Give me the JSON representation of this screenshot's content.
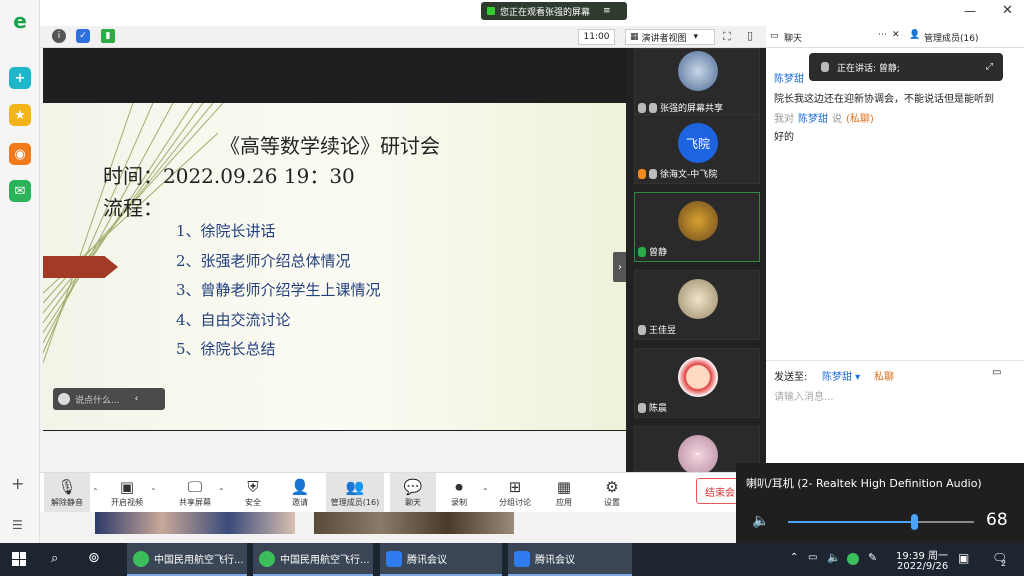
{
  "top_banner": {
    "text": "您正在观看张强的屏幕"
  },
  "meeting": {
    "clock": "11:00",
    "view_label": "演讲者视图"
  },
  "slide": {
    "title": "《高等数学续论》研讨会",
    "time_line": "时间：2022.09.26 19：30",
    "flow_label": "流程：",
    "items": [
      "1、徐院长讲话",
      "2、张强老师介绍总体情况",
      "3、曾静老师介绍学生上课情况",
      "4、自由交流讨论",
      "5、徐院长总结"
    ]
  },
  "say_box": {
    "placeholder": "说点什么..."
  },
  "participants": [
    {
      "name": "张强的屏幕共享"
    },
    {
      "name": "徐海文-中飞院",
      "avatar_text": "飞院"
    },
    {
      "name": "曾静"
    },
    {
      "name": "王佳昱"
    },
    {
      "name": "陈晨"
    }
  ],
  "chat": {
    "tab_label": "聊天",
    "members_label": "管理成员(16)",
    "speaking_label": "正在讲话: 曾静;",
    "messages": [
      {
        "sender": "陈梦甜",
        "text": "院长我这边还在迎新协调会，不能说话但是能听到"
      },
      {
        "prefix": "我对",
        "sender": "陈梦甜",
        "verb": "说",
        "tag": "(私聊)",
        "text": "好的"
      }
    ],
    "send_to_label": "发送至:",
    "send_to_name": "陈梦甜",
    "private_label": "私聊",
    "input_placeholder": "请输入消息..."
  },
  "toolbar": {
    "items": [
      "解除静音",
      "开启视频",
      "共享屏幕",
      "安全",
      "邀请",
      "管理成员(16)",
      "聊天",
      "录制",
      "分组讨论",
      "应用",
      "设置"
    ],
    "end_label": "结束会"
  },
  "volume": {
    "device": "喇叭/耳机 (2- Realtek High Definition Audio)",
    "level": "68",
    "level_fraction": 0.68
  },
  "taskbar": {
    "apps": [
      "中国民用航空飞行...",
      "中国民用航空飞行...",
      "腾讯会议",
      "腾讯会议"
    ],
    "time": "19:39 周一",
    "date": "2022/9/26",
    "notif_count": "2"
  },
  "colors": {
    "accent": "#1a6fe0",
    "end_red": "#dd3333",
    "slide_text": "#24407e"
  }
}
